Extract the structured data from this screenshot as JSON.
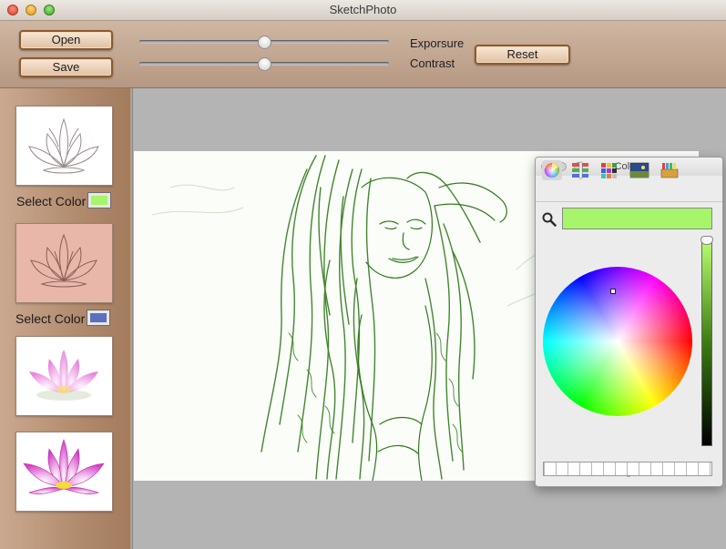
{
  "window": {
    "title": "SketchPhoto"
  },
  "toolbar": {
    "open_label": "Open",
    "save_label": "Save",
    "reset_label": "Reset",
    "exposure_label": "Exporsure",
    "contrast_label": "Contrast",
    "exposure_value": 0.5,
    "contrast_value": 0.5
  },
  "sidebar": {
    "select_color_1": {
      "label": "Select Color",
      "color": "#a6f56a"
    },
    "select_color_2": {
      "label": "Select Color",
      "color": "#5a6fbf"
    },
    "thumbnails": [
      "lotus-sketch-white",
      "lotus-sketch-pink",
      "lotus-photo-soft",
      "lotus-photo"
    ]
  },
  "main": {
    "sketch_color": "#2f7a1a",
    "background_color": "#fbfdf9"
  },
  "colors_panel": {
    "title": "Colors",
    "tabs": [
      "color-wheel",
      "color-sliders",
      "color-palettes",
      "image-palettes",
      "crayons"
    ],
    "current_color": "#a6f56a"
  },
  "theme": {
    "toolbar_bg": "#c4aa95",
    "sidebar_bg": "#b38d70",
    "canvas_bg": "#b4b4b4",
    "button_border": "#8a5a30"
  }
}
